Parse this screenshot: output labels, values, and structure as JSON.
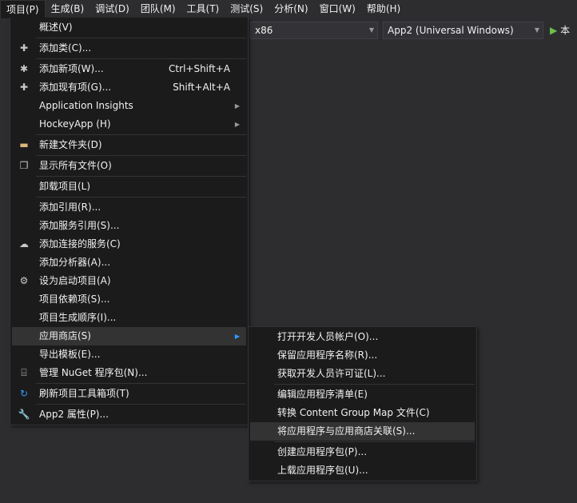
{
  "menubar": [
    "项目(P)",
    "生成(B)",
    "调试(D)",
    "团队(M)",
    "工具(T)",
    "测试(S)",
    "分析(N)",
    "窗口(W)",
    "帮助(H)"
  ],
  "toolbar": {
    "platform": "x86",
    "target": "App2 (Universal Windows)",
    "run_label": "本"
  },
  "project_menu": [
    {
      "label": "概述(V)"
    },
    "sep",
    {
      "label": "添加类(C)...",
      "icon": "add-class-icon",
      "glyph": "✚"
    },
    "sep",
    {
      "label": "添加新项(W)...",
      "shortcut": "Ctrl+Shift+A",
      "icon": "add-new-item-icon",
      "glyph": "✱"
    },
    {
      "label": "添加现有项(G)...",
      "shortcut": "Shift+Alt+A",
      "icon": "add-existing-item-icon",
      "glyph": "✚"
    },
    {
      "label": "Application Insights",
      "submenu": true
    },
    {
      "label": "HockeyApp (H)",
      "submenu": true
    },
    "sep",
    {
      "label": "新建文件夹(D)",
      "icon": "new-folder-icon",
      "glyph": "▬"
    },
    "sep",
    {
      "label": "显示所有文件(O)",
      "icon": "show-all-files-icon",
      "glyph": "❐"
    },
    "sep",
    {
      "label": "卸载项目(L)"
    },
    "sep",
    {
      "label": "添加引用(R)..."
    },
    {
      "label": "添加服务引用(S)..."
    },
    {
      "label": "添加连接的服务(C)",
      "icon": "connected-service-icon",
      "glyph": "☁"
    },
    {
      "label": "添加分析器(A)..."
    },
    {
      "label": "设为启动项目(A)",
      "icon": "gear-icon",
      "glyph": "⚙"
    },
    {
      "label": "项目依赖项(S)..."
    },
    {
      "label": "项目生成顺序(I)..."
    },
    {
      "label": "应用商店(S)",
      "submenu": true,
      "highlighted": true
    },
    {
      "label": "导出模板(E)..."
    },
    {
      "label": "管理 NuGet 程序包(N)...",
      "icon": "nuget-package-icon",
      "glyph": "⌸"
    },
    "sep",
    {
      "label": "刷新项目工具箱项(T)",
      "icon": "refresh-icon",
      "glyph": "↻"
    },
    "sep",
    {
      "label": "App2 属性(P)...",
      "icon": "wrench-icon",
      "glyph": "🔧"
    }
  ],
  "store_submenu": [
    {
      "label": "打开开发人员帐户(O)..."
    },
    {
      "label": "保留应用程序名称(R)..."
    },
    {
      "label": "获取开发人员许可证(L)..."
    },
    "sep",
    {
      "label": "编辑应用程序清单(E)"
    },
    {
      "label": "转换 Content Group Map 文件(C)"
    },
    {
      "label": "将应用程序与应用商店关联(S)...",
      "highlighted": true
    },
    "sep",
    {
      "label": "创建应用程序包(P)..."
    },
    {
      "label": "上载应用程序包(U)..."
    }
  ]
}
